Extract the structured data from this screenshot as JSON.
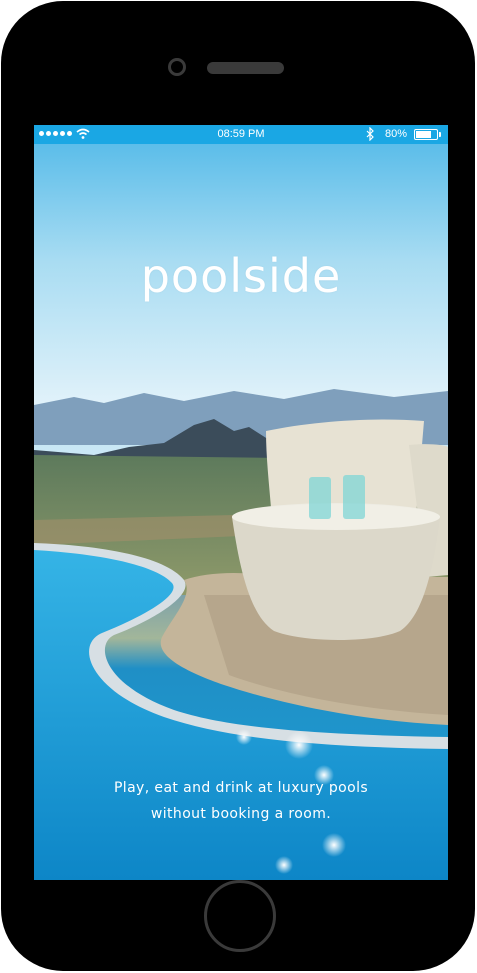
{
  "status_bar": {
    "time": "08:59 PM",
    "battery_percent_label": "80%",
    "battery_level": 0.8,
    "icons": [
      "signal-dots-icon",
      "wifi-icon",
      "bluetooth-icon",
      "battery-icon"
    ]
  },
  "splash": {
    "logo_text": "poolside",
    "tagline_line1": "Play, eat and drink at luxury pools",
    "tagline_line2": "without booking a room."
  },
  "colors": {
    "status_bar": "#1aa7e4",
    "phone_body": "#000000",
    "text": "#ffffff"
  }
}
